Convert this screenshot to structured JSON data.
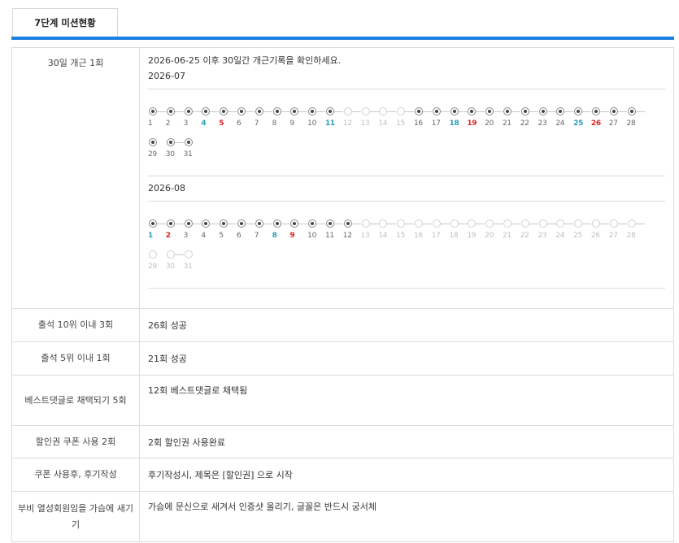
{
  "tab": {
    "label": "7단계 미션현황"
  },
  "attendance": {
    "label": "30일 개근 1회",
    "description": "2026-06-25 이후 30일간 개근기록을 확인하세요.",
    "months": [
      {
        "label": "2026-07",
        "days": [
          {
            "n": "1",
            "done": true,
            "color": "normal"
          },
          {
            "n": "2",
            "done": true,
            "color": "normal"
          },
          {
            "n": "3",
            "done": true,
            "color": "normal"
          },
          {
            "n": "4",
            "done": true,
            "color": "blue"
          },
          {
            "n": "5",
            "done": true,
            "color": "red"
          },
          {
            "n": "6",
            "done": true,
            "color": "normal"
          },
          {
            "n": "7",
            "done": true,
            "color": "normal"
          },
          {
            "n": "8",
            "done": true,
            "color": "normal"
          },
          {
            "n": "9",
            "done": true,
            "color": "normal"
          },
          {
            "n": "10",
            "done": true,
            "color": "normal"
          },
          {
            "n": "11",
            "done": true,
            "color": "blue"
          },
          {
            "n": "12",
            "done": false,
            "color": "normal"
          },
          {
            "n": "13",
            "done": false,
            "color": "normal"
          },
          {
            "n": "14",
            "done": false,
            "color": "normal"
          },
          {
            "n": "15",
            "done": false,
            "color": "normal"
          },
          {
            "n": "16",
            "done": true,
            "color": "normal"
          },
          {
            "n": "17",
            "done": true,
            "color": "normal"
          },
          {
            "n": "18",
            "done": true,
            "color": "blue"
          },
          {
            "n": "19",
            "done": true,
            "color": "red"
          },
          {
            "n": "20",
            "done": true,
            "color": "normal"
          },
          {
            "n": "21",
            "done": true,
            "color": "normal"
          },
          {
            "n": "22",
            "done": true,
            "color": "normal"
          },
          {
            "n": "23",
            "done": true,
            "color": "normal"
          },
          {
            "n": "24",
            "done": true,
            "color": "normal"
          },
          {
            "n": "25",
            "done": true,
            "color": "blue"
          },
          {
            "n": "26",
            "done": true,
            "color": "red"
          },
          {
            "n": "27",
            "done": true,
            "color": "normal"
          },
          {
            "n": "28",
            "done": true,
            "color": "normal"
          },
          {
            "n": "29",
            "done": true,
            "color": "normal"
          },
          {
            "n": "30",
            "done": true,
            "color": "normal"
          },
          {
            "n": "31",
            "done": true,
            "color": "normal"
          }
        ]
      },
      {
        "label": "2026-08",
        "days": [
          {
            "n": "1",
            "done": true,
            "color": "blue"
          },
          {
            "n": "2",
            "done": true,
            "color": "red"
          },
          {
            "n": "3",
            "done": true,
            "color": "normal"
          },
          {
            "n": "4",
            "done": true,
            "color": "normal"
          },
          {
            "n": "5",
            "done": true,
            "color": "normal"
          },
          {
            "n": "6",
            "done": true,
            "color": "normal"
          },
          {
            "n": "7",
            "done": true,
            "color": "normal"
          },
          {
            "n": "8",
            "done": true,
            "color": "blue"
          },
          {
            "n": "9",
            "done": true,
            "color": "red"
          },
          {
            "n": "10",
            "done": true,
            "color": "normal"
          },
          {
            "n": "11",
            "done": true,
            "color": "normal"
          },
          {
            "n": "12",
            "done": true,
            "color": "normal"
          },
          {
            "n": "13",
            "done": false,
            "color": "normal"
          },
          {
            "n": "14",
            "done": false,
            "color": "normal"
          },
          {
            "n": "15",
            "done": false,
            "color": "normal"
          },
          {
            "n": "16",
            "done": false,
            "color": "normal"
          },
          {
            "n": "17",
            "done": false,
            "color": "normal"
          },
          {
            "n": "18",
            "done": false,
            "color": "normal"
          },
          {
            "n": "19",
            "done": false,
            "color": "normal"
          },
          {
            "n": "20",
            "done": false,
            "color": "normal"
          },
          {
            "n": "21",
            "done": false,
            "color": "normal"
          },
          {
            "n": "22",
            "done": false,
            "color": "normal"
          },
          {
            "n": "23",
            "done": false,
            "color": "normal"
          },
          {
            "n": "24",
            "done": false,
            "color": "normal"
          },
          {
            "n": "25",
            "done": false,
            "color": "normal"
          },
          {
            "n": "26",
            "done": false,
            "color": "normal"
          },
          {
            "n": "27",
            "done": false,
            "color": "normal"
          },
          {
            "n": "28",
            "done": false,
            "color": "normal"
          },
          {
            "n": "29",
            "done": false,
            "color": "normal"
          },
          {
            "n": "30",
            "done": false,
            "color": "normal"
          },
          {
            "n": "31",
            "done": false,
            "color": "normal"
          }
        ]
      }
    ]
  },
  "rows": [
    {
      "label": "출석 10위 이내 3회",
      "value": "26회 성공"
    },
    {
      "label": "출석 5위 이내 1회",
      "value": "21회 성공"
    },
    {
      "label": "베스트댓글로 채택되기 5회",
      "value": "12회 베스트댓글로 채택됨"
    },
    {
      "label": "할인권 쿠폰 사용 2회",
      "value": "2회 할인권 사용완료"
    },
    {
      "label": "쿠폰 사용후, 후기작성",
      "value": "후기작성시, 제목은 [할인권] 으로 시작"
    },
    {
      "label": "부비 열성회원임을 가슴에 새기기",
      "value": "가슴에 문신으로 새겨서 인증샷 올리기, 글꼴은 반드시 궁서체"
    }
  ],
  "colors": {
    "accent": "#1d7fe0",
    "sunday": "#e02020",
    "saturday": "#2aa0b8"
  }
}
